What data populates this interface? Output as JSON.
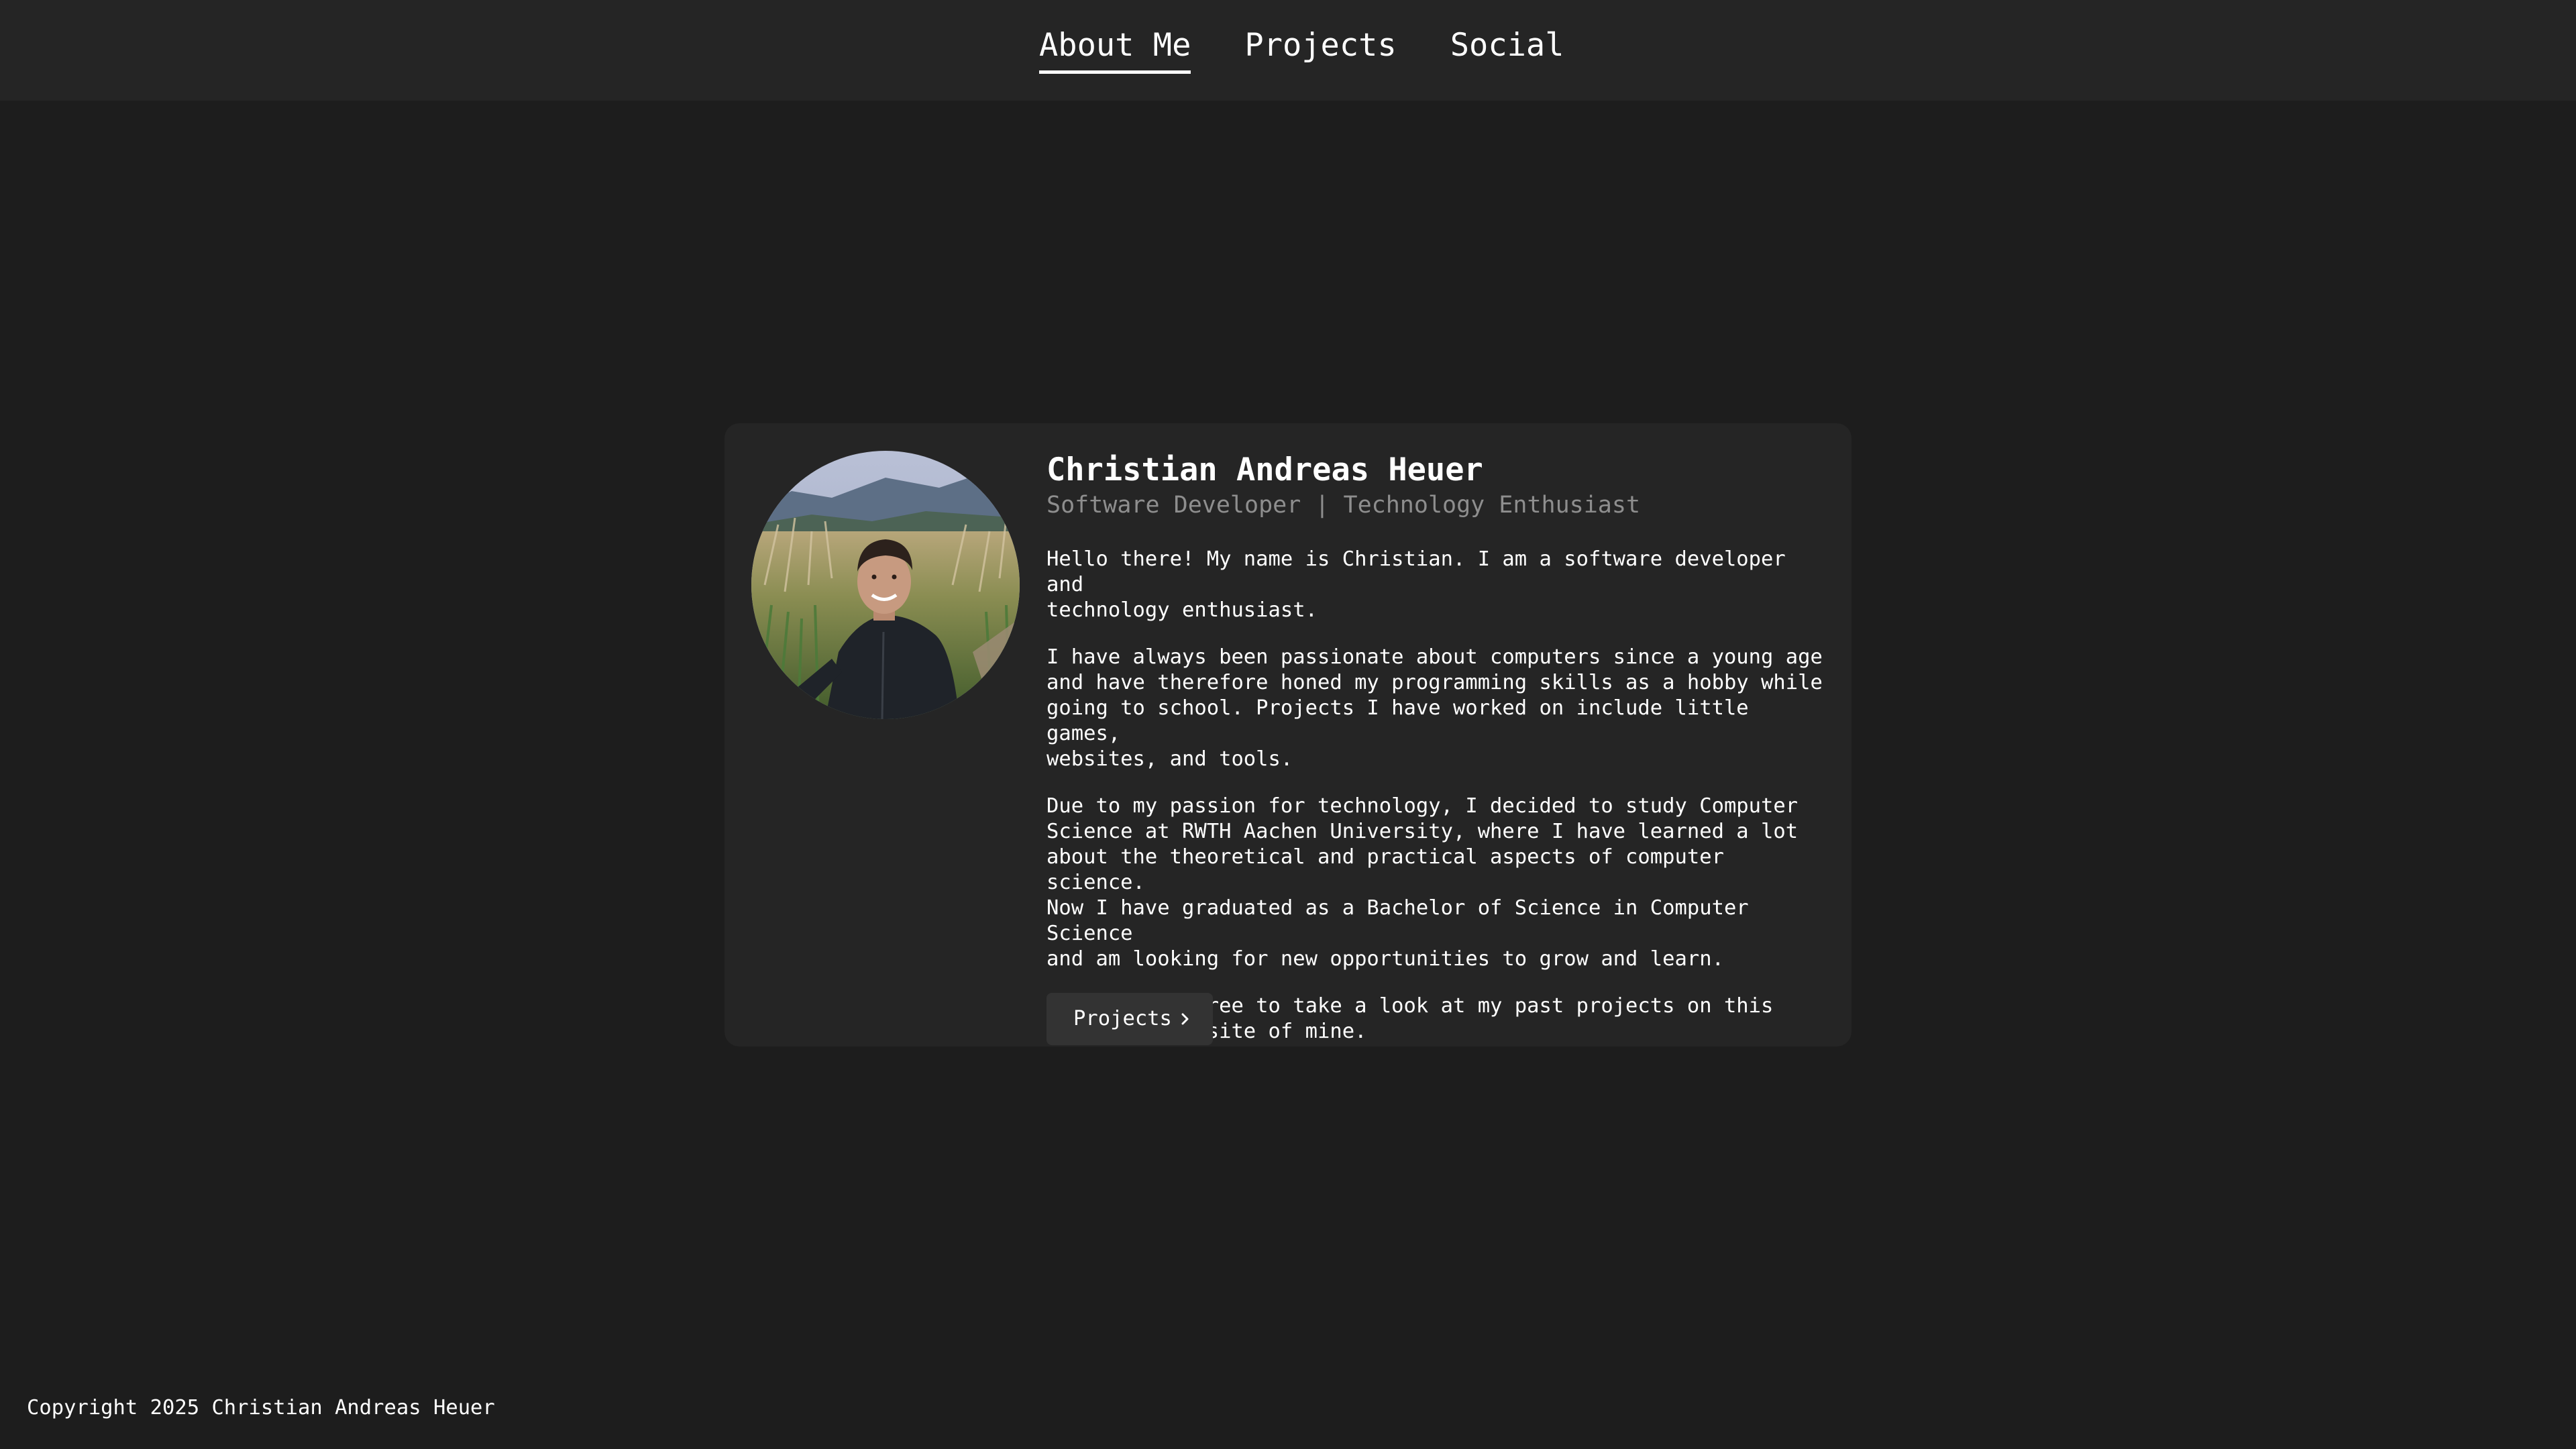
{
  "nav": {
    "items": [
      {
        "label": "About Me",
        "active": true
      },
      {
        "label": "Projects",
        "active": false
      },
      {
        "label": "Social",
        "active": false
      }
    ]
  },
  "profile": {
    "name": "Christian Andreas Heuer",
    "subtitle": "Software Developer | Technology Enthusiast",
    "paragraphs": [
      "Hello there! My name is Christian. I am a software developer and\ntechnology enthusiast.",
      "I have always been passionate about computers since a young age\nand have therefore honed my programming skills as a hobby while\ngoing to school. Projects I have worked on include little games,\nwebsites, and tools.",
      "Due to my passion for technology, I decided to study Computer\nScience at RWTH Aachen University, where I have learned a lot\nabout the theoretical and practical aspects of computer science.\nNow I have graduated as a Bachelor of Science in Computer Science\nand am looking for new opportunities to grow and learn.",
      "Please feel free to take a look at my past projects on this\nportfolio website of mine."
    ],
    "button_label": "Projects",
    "button_icon": "chevron-right-icon"
  },
  "footer": {
    "copyright": "Copyright 2025 Christian Andreas Heuer"
  },
  "colors": {
    "background": "#1d1d1d",
    "surface": "#252525",
    "button": "#333333",
    "text": "#ffffff",
    "muted": "#8e8e8e"
  }
}
